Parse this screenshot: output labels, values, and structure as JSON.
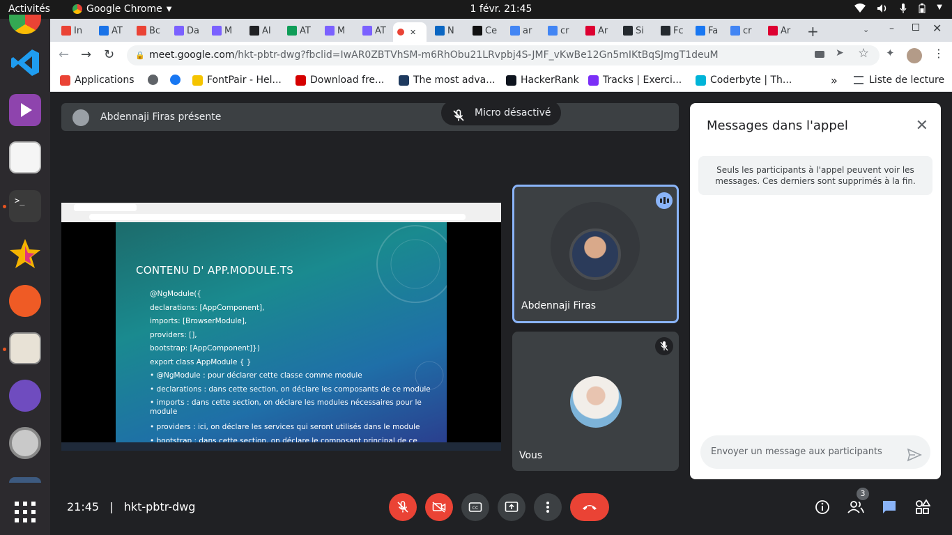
{
  "system": {
    "activities": "Activités",
    "app_name": "Google Chrome",
    "clock": "1 févr.  21:45"
  },
  "tabs": [
    {
      "label": "In",
      "favicon_color": "#ea4335",
      "icon": "gmail-icon"
    },
    {
      "label": "AT",
      "favicon_color": "#1a73e8",
      "icon": "calendar-icon"
    },
    {
      "label": "Bc",
      "favicon_color": "#ea4335",
      "icon": "gmail-icon"
    },
    {
      "label": "Da",
      "favicon_color": "#7b61ff",
      "icon": "app-icon"
    },
    {
      "label": "M",
      "favicon_color": "#7b61ff",
      "icon": "app-icon"
    },
    {
      "label": "AI",
      "favicon_color": "#202124",
      "icon": "app-icon"
    },
    {
      "label": "AT",
      "favicon_color": "#0f9d58",
      "icon": "sheets-icon"
    },
    {
      "label": "M",
      "favicon_color": "#7b61ff",
      "icon": "app-icon"
    },
    {
      "label": "AT",
      "favicon_color": "#7b61ff",
      "icon": "app-icon"
    },
    {
      "label": "",
      "favicon_color": "#ea4335",
      "icon": "recording-icon",
      "active": true
    },
    {
      "label": "N",
      "favicon_color": "#0a66c2",
      "icon": "linkedin-icon"
    },
    {
      "label": "Ce",
      "favicon_color": "#111111",
      "icon": "app-icon"
    },
    {
      "label": "ar",
      "favicon_color": "#4285f4",
      "icon": "google-icon"
    },
    {
      "label": "cr",
      "favicon_color": "#4285f4",
      "icon": "google-icon"
    },
    {
      "label": "Ar",
      "favicon_color": "#dd0031",
      "icon": "angular-icon"
    },
    {
      "label": "Si",
      "favicon_color": "#24292e",
      "icon": "github-icon"
    },
    {
      "label": "Fc",
      "favicon_color": "#24292e",
      "icon": "github-icon"
    },
    {
      "label": "Fa",
      "favicon_color": "#1877f2",
      "icon": "facebook-icon"
    },
    {
      "label": "cr",
      "favicon_color": "#4285f4",
      "icon": "google-icon"
    },
    {
      "label": "Ar",
      "favicon_color": "#dd0031",
      "icon": "angular-icon"
    }
  ],
  "url": {
    "domain": "meet.google.com",
    "path": "/hkt-pbtr-dwg?fbclid=IwAR0ZBTVhSM-m6RhObu21LRvpbj4S-JMF_vKwBe12Gn5mIKtBqSJmgT1deuM"
  },
  "bookmarks": [
    {
      "label": "Applications",
      "color": "#ea4335"
    },
    {
      "label": "",
      "color": "#5f6368"
    },
    {
      "label": "",
      "color": "#1877f2"
    },
    {
      "label": "FontPair - Hel...",
      "color": "#f5c400"
    },
    {
      "label": "Download fre...",
      "color": "#d50000"
    },
    {
      "label": "The most adva...",
      "color": "#1e3a5f"
    },
    {
      "label": "HackerRank",
      "color": "#0e141e"
    },
    {
      "label": "Tracks | Exerci...",
      "color": "#7b2ff7"
    },
    {
      "label": "Coderbyte | Th...",
      "color": "#00b4d8"
    }
  ],
  "bookmarks_more": "»",
  "reading_list": "Liste de lecture",
  "meet": {
    "presenter": "Abdennaji Firas présente",
    "mic_status": "Micro désactivé",
    "slide": {
      "title": "CONTENU D' APP.MODULE.TS",
      "lines": [
        "@NgModule({",
        "declarations: [AppComponent],",
        "imports: [BrowserModule],",
        "providers: [],",
        "bootstrap: [AppComponent]})",
        "export class AppModule { }",
        "• @NgModule : pour déclarer cette classe comme module",
        "• declarations : dans cette section, on déclare les composants de ce module",
        "• imports : dans cette section, on déclare les modules nécessaires pour le module",
        "• providers : ici, on déclare les services qui seront utilisés dans le module",
        "• bootstrap : dans cette section, on déclare le composant principal de ce"
      ]
    },
    "participants": [
      {
        "name": "Abdennaji Firas",
        "speaking": true
      },
      {
        "name": "Vous",
        "muted": true
      }
    ],
    "chat": {
      "title": "Messages dans l'appel",
      "notice": "Seuls les participants à l'appel peuvent voir les messages. Ces derniers sont supprimés à la fin.",
      "placeholder": "Envoyer un message aux participants"
    },
    "bottom": {
      "time": "21:45",
      "separator": "|",
      "meeting_code": "hkt-pbtr-dwg",
      "participant_count": "3"
    }
  }
}
